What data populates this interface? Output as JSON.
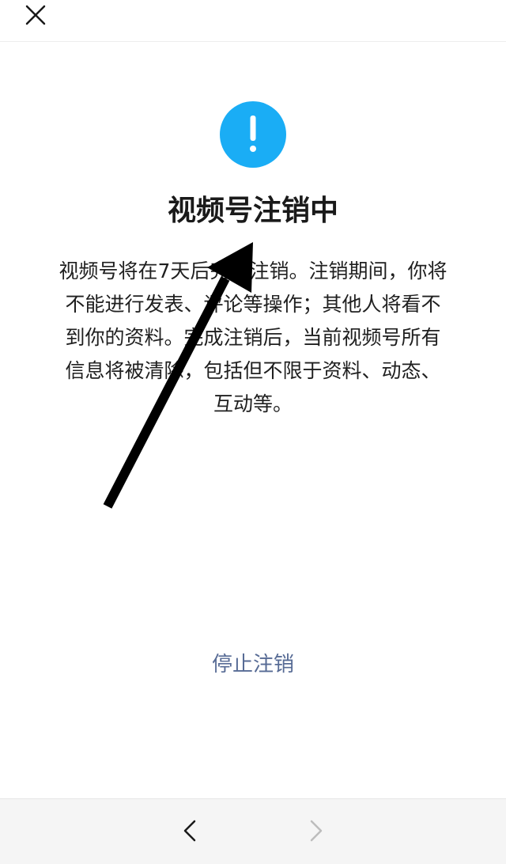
{
  "top_bar": {
    "close_icon": "close-icon"
  },
  "warning": {
    "icon": "exclamation-circle-icon",
    "color": "#1aadf5"
  },
  "title": "视频号注销中",
  "description_lines": [
    "视频号将在7天后完成注销。注销期间，你将",
    "不能进行发表、评论等操作；其他人将看不",
    "到你的资料。完成注销后，当前视频号所有",
    "信息将被清除，包括但不限于资料、动态、",
    "互动等。"
  ],
  "stop_link": {
    "label": "停止注销",
    "color": "#576b95"
  },
  "bottom_nav": {
    "back_icon": "chevron-left-icon",
    "forward_icon": "chevron-right-icon",
    "forward_enabled": false
  },
  "annotation": {
    "icon": "arrow-annotation",
    "color": "#000000"
  }
}
